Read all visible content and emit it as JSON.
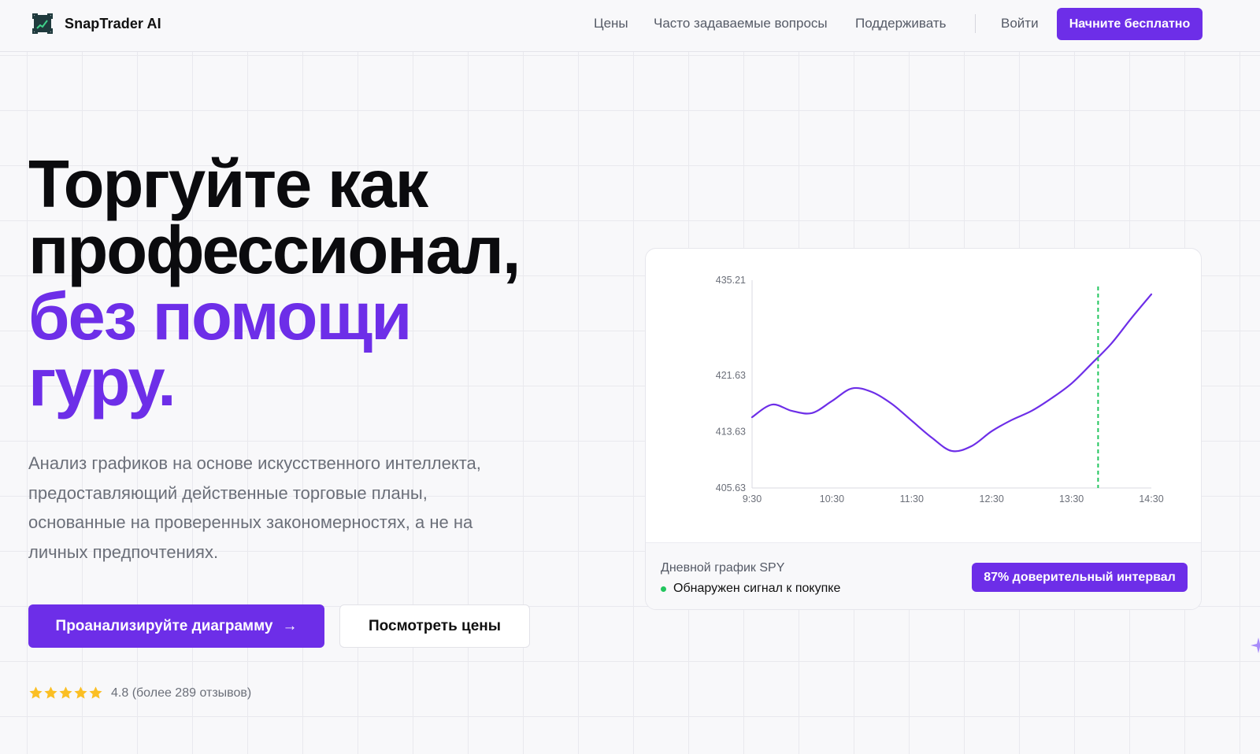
{
  "header": {
    "brand": "SnapTrader AI",
    "nav": [
      {
        "label": "Цены"
      },
      {
        "label": "Часто задаваемые вопросы"
      },
      {
        "label": "Поддерживать"
      }
    ],
    "login": "Войти",
    "cta": "Начните бесплатно"
  },
  "hero": {
    "headline_line1": "Торгуйте как",
    "headline_line2": "профессионал,",
    "headline_line3": "без помощи",
    "headline_line4": "гуру.",
    "subtitle": "Анализ графиков на основе искусственного интеллекта, предоставляющий действенные торговые планы, основанные на проверенных закономерностях, а не на личных предпочтениях.",
    "primary_button": "Проанализируйте диаграмму",
    "primary_button_icon": "→",
    "secondary_button": "Посмотреть цены",
    "rating": {
      "stars": 5,
      "text": "4.8 (более 289 отзывов)"
    }
  },
  "card": {
    "chart_caption": "Дневной график SPY",
    "signal": "Обнаружен сигнал к покупке",
    "confidence": "87% доверительный интервал"
  },
  "colors": {
    "accent": "#6d2ee8",
    "signal_green": "#22c55e",
    "star_yellow": "#fbbf24"
  },
  "chart_data": {
    "type": "line",
    "x_ticks": [
      "9:30",
      "10:30",
      "11:30",
      "12:30",
      "13:30",
      "14:30"
    ],
    "y_ticks": [
      "435.21",
      "421.63",
      "413.63",
      "405.63"
    ],
    "ylim": [
      405.63,
      435.21
    ],
    "x": [
      "9:30",
      "9:45",
      "10:00",
      "10:15",
      "10:30",
      "10:45",
      "11:00",
      "11:15",
      "11:30",
      "11:45",
      "12:00",
      "12:15",
      "12:30",
      "12:45",
      "13:00",
      "13:15",
      "13:30",
      "13:45",
      "14:00",
      "14:15",
      "14:30"
    ],
    "values": [
      415.7,
      417.5,
      416.6,
      416.3,
      418.0,
      419.8,
      419.3,
      417.6,
      415.2,
      412.8,
      410.9,
      411.6,
      413.7,
      415.3,
      416.6,
      418.4,
      420.5,
      423.3,
      426.2,
      429.8,
      433.2
    ],
    "vertical_marker": "13:50",
    "grid": false
  }
}
